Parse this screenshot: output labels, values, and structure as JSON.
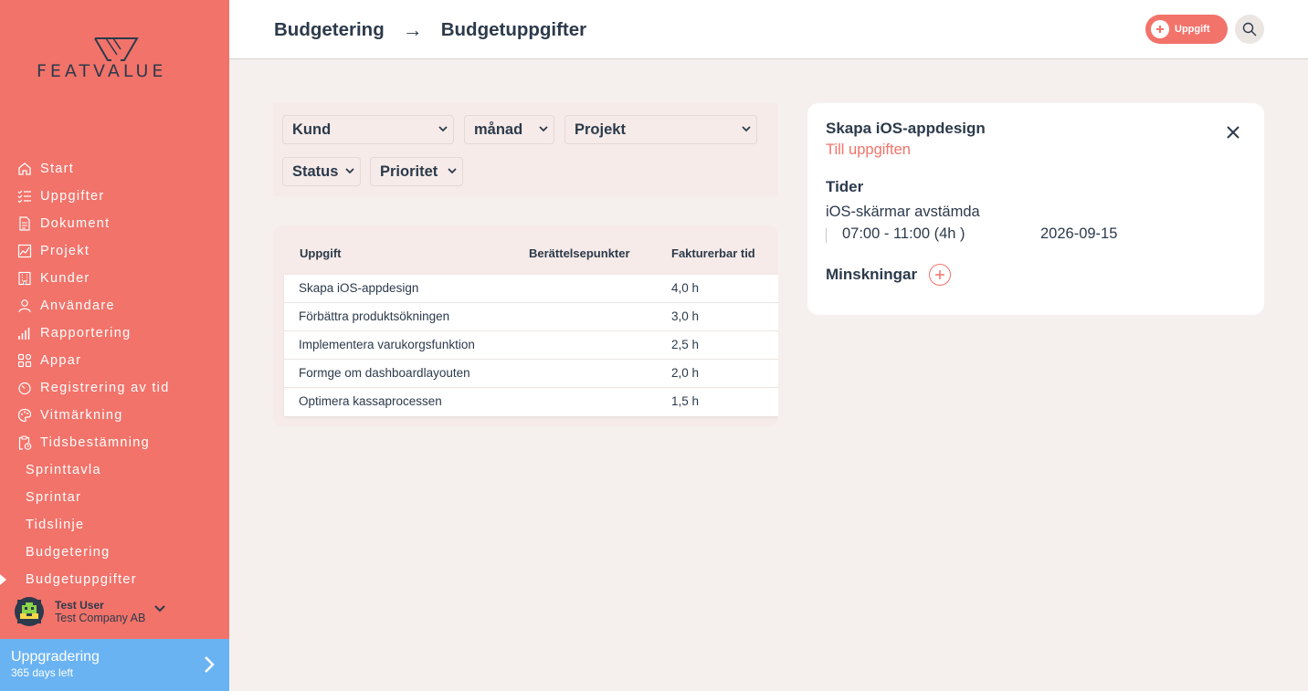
{
  "brand": {
    "logo_text": "FEATVALUE",
    "accent": "#f2736a",
    "upgrade_color": "#6ab3f3",
    "text_color": "#2c3a4b"
  },
  "sidebar": {
    "items": [
      {
        "label": "Start",
        "icon": "home-icon"
      },
      {
        "label": "Uppgifter",
        "icon": "checklist-icon"
      },
      {
        "label": "Dokument",
        "icon": "document-icon"
      },
      {
        "label": "Projekt",
        "icon": "chart-icon"
      },
      {
        "label": "Kunder",
        "icon": "building-icon"
      },
      {
        "label": "Användare",
        "icon": "user-icon"
      },
      {
        "label": "Rapportering",
        "icon": "bar-chart-icon"
      },
      {
        "label": "Appar",
        "icon": "apps-icon"
      },
      {
        "label": "Registrering av tid",
        "icon": "timer-icon"
      },
      {
        "label": "Vitmärkning",
        "icon": "palette-icon"
      },
      {
        "label": "Tidsbestämning",
        "icon": "clipboard-clock-icon"
      }
    ],
    "subitems": [
      {
        "label": "Sprinttavla"
      },
      {
        "label": "Sprintar"
      },
      {
        "label": "Tidslinje"
      },
      {
        "label": "Budgetering"
      },
      {
        "label": "Budgetuppgifter",
        "active": true
      }
    ],
    "user": {
      "name": "Test User",
      "company": "Test Company AB"
    },
    "upgrade": {
      "title": "Uppgradering",
      "subtitle": "365 days left"
    }
  },
  "header": {
    "breadcrumb": [
      "Budgetering",
      "Budgetuppgifter"
    ],
    "separator": "→",
    "add_button": "Uppgift"
  },
  "filters": {
    "kund": "Kund",
    "manad": "månad",
    "projekt": "Projekt",
    "status": "Status",
    "prioritet": "Prioritet"
  },
  "table": {
    "columns": [
      "Uppgift",
      "Berättelsepunkter",
      "Fakturerbar tid"
    ],
    "rows": [
      {
        "task": "Skapa iOS-appdesign",
        "points": "",
        "time": "4,0 h"
      },
      {
        "task": "Förbättra produktsökningen",
        "points": "",
        "time": "3,0 h"
      },
      {
        "task": "Implementera varukorgsfunktion",
        "points": "",
        "time": "2,5 h"
      },
      {
        "task": "Formge om dashboardlayouten",
        "points": "",
        "time": "2,0 h"
      },
      {
        "task": "Optimera kassaprocessen",
        "points": "",
        "time": "1,5 h"
      }
    ]
  },
  "detail": {
    "title": "Skapa iOS-appdesign",
    "link": "Till uppgiften",
    "times_heading": "Tider",
    "time_entry": {
      "title": "iOS-skärmar avstämda",
      "range": "07:00 - 11:00 (4h )",
      "date": "2026-09-15"
    },
    "reductions_heading": "Minskningar"
  }
}
